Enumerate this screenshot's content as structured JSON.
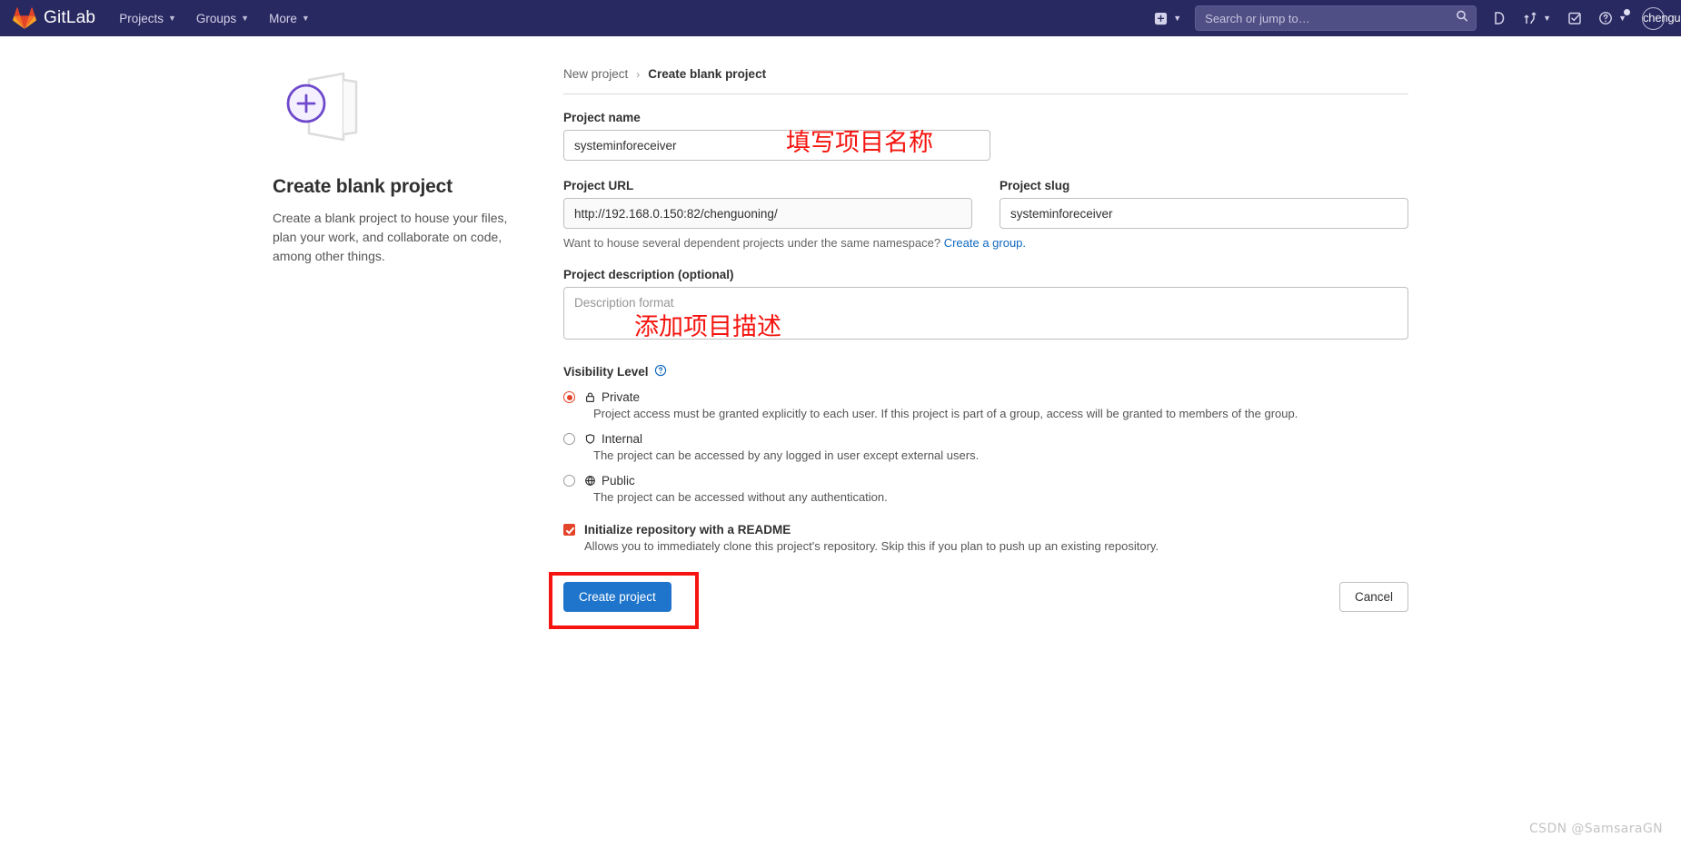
{
  "navbar": {
    "brand": "GitLab",
    "items": [
      {
        "label": "Projects",
        "icon": "chevron-down-icon"
      },
      {
        "label": "Groups",
        "icon": "chevron-down-icon"
      },
      {
        "label": "More",
        "icon": "chevron-down-icon"
      }
    ],
    "create_new_icon": "plus-square-icon",
    "search": {
      "placeholder": "Search or jump to…",
      "value": "",
      "icon": "search-icon"
    },
    "right_icons": [
      "issues-icon",
      "merge-requests-icon",
      "todos-icon",
      "help-icon"
    ],
    "user": {
      "name": "chenguoning",
      "avatar": "user-avatar"
    },
    "colors": {
      "background": "#292961",
      "text": "#d3d2ea",
      "search_bg": "#4f4f86"
    }
  },
  "left_panel": {
    "title": "Create blank project",
    "description": "Create a blank project to house your files, plan your work, and collaborate on code, among other things.",
    "illustration": "blank-project-illustration"
  },
  "breadcrumb": {
    "parent": "New project",
    "separator": "›",
    "current": "Create blank project"
  },
  "form": {
    "project_name": {
      "label": "Project name",
      "value": "systeminforeceiver",
      "placeholder": ""
    },
    "project_url": {
      "label": "Project URL",
      "value": "http://192.168.0.150:82/chenguoning/"
    },
    "project_slug": {
      "label": "Project slug",
      "value": "systeminforeceiver"
    },
    "namespace_help": {
      "text": "Want to house several dependent projects under the same namespace?",
      "link": "Create a group."
    },
    "description": {
      "label": "Project description (optional)",
      "placeholder": "Description format",
      "value": ""
    },
    "visibility": {
      "label": "Visibility Level",
      "help_icon": "question-circle-icon",
      "selected": "private",
      "options": [
        {
          "id": "private",
          "name": "Private",
          "icon": "lock-icon",
          "description": "Project access must be granted explicitly to each user. If this project is part of a group, access will be granted to members of the group."
        },
        {
          "id": "internal",
          "name": "Internal",
          "icon": "shield-icon",
          "description": "The project can be accessed by any logged in user except external users."
        },
        {
          "id": "public",
          "name": "Public",
          "icon": "globe-icon",
          "description": "The project can be accessed without any authentication."
        }
      ]
    },
    "readme": {
      "label": "Initialize repository with a README",
      "description": "Allows you to immediately clone this project's repository. Skip this if you plan to push up an existing repository.",
      "checked": true
    },
    "actions": {
      "submit": "Create project",
      "cancel": "Cancel"
    }
  },
  "annotations": [
    {
      "id": "name-annotation",
      "text": "填写项目名称"
    },
    {
      "id": "description-annotation",
      "text": "添加项目描述"
    }
  ],
  "watermark": "CSDN @SamsaraGN",
  "colors": {
    "accent_orange": "#e24329",
    "primary_blue": "#1f75cb",
    "link_blue": "#1068bf",
    "annotation_red": "#f5140f"
  }
}
